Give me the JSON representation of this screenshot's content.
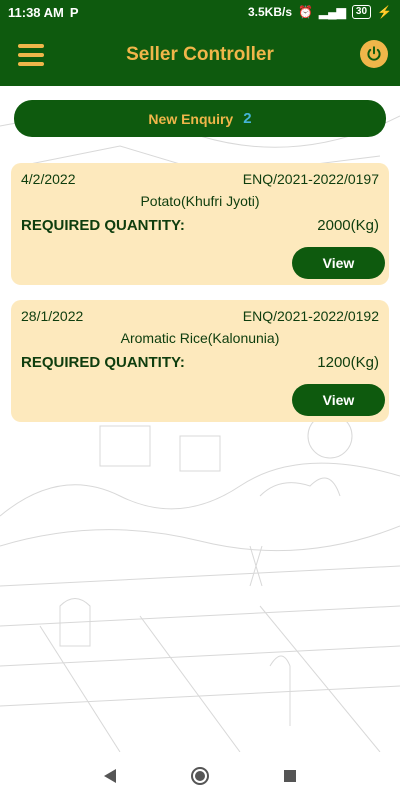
{
  "status_bar": {
    "time": "11:38 AM",
    "app_badge": "P",
    "network_speed": "3.5KB/s",
    "battery": "30"
  },
  "app_bar": {
    "title": "Seller Controller"
  },
  "new_enquiry": {
    "label": "New Enquiry",
    "count": "2"
  },
  "enquiries": [
    {
      "date": "4/2/2022",
      "enquiry_no": "ENQ/2021-2022/0197",
      "product": "Potato(Khufri Jyoti)",
      "required_label": "REQUIRED QUANTITY:",
      "quantity": "2000(Kg)",
      "view_label": "View"
    },
    {
      "date": "28/1/2022",
      "enquiry_no": "ENQ/2021-2022/0192",
      "product": "Aromatic Rice(Kalonunia)",
      "required_label": "REQUIRED QUANTITY:",
      "quantity": "1200(Kg)",
      "view_label": "View"
    }
  ],
  "colors": {
    "primary_green": "#0e5a0e",
    "accent_gold": "#f0b64a",
    "card_bg": "#fde9bd",
    "count_blue": "#45b3d6"
  },
  "icons": {
    "menu": "hamburger-menu-icon",
    "power": "power-icon",
    "nav_back": "back-triangle-icon",
    "nav_home": "home-circle-icon",
    "nav_recents": "recents-square-icon"
  }
}
